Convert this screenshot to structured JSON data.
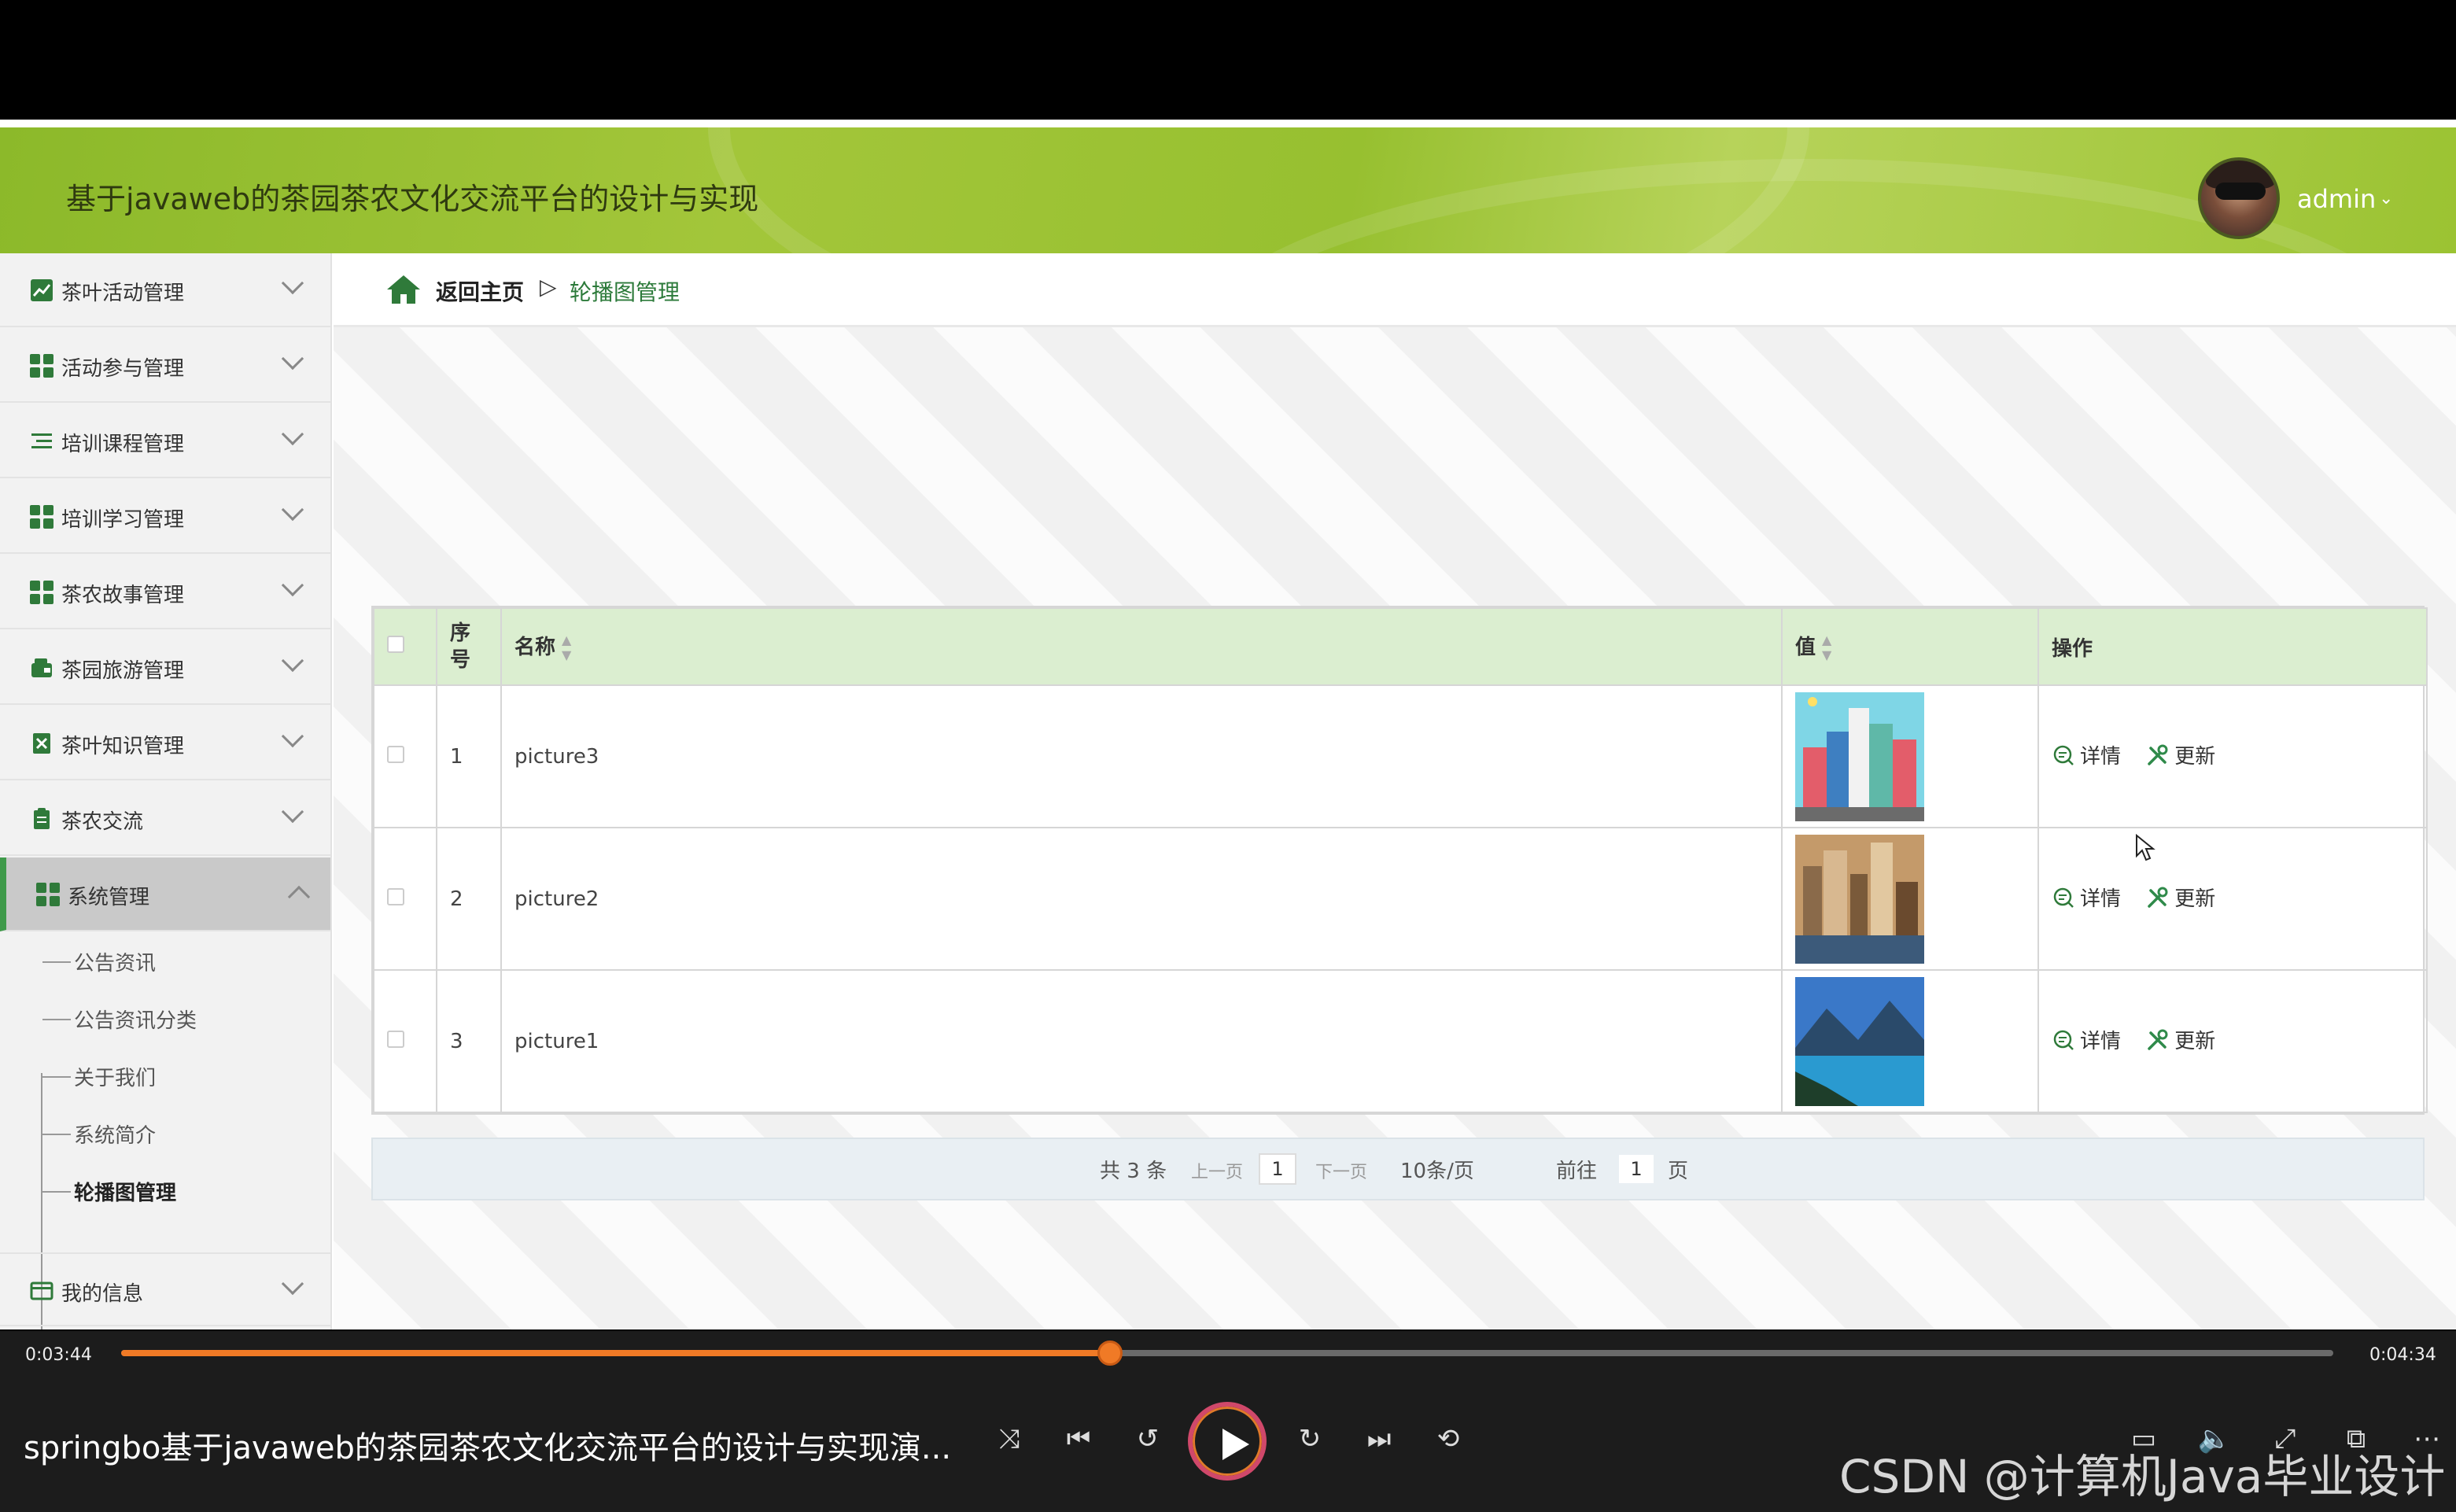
{
  "app": {
    "title": "基于javaweb的茶园茶农文化交流平台的设计与实现",
    "user": "admin",
    "user_caret": "⌄"
  },
  "sidebar": {
    "items": [
      {
        "label": "茶叶活动管理",
        "icon": "chart-icon"
      },
      {
        "label": "活动参与管理",
        "icon": "grid-icon"
      },
      {
        "label": "培训课程管理",
        "icon": "list-icon"
      },
      {
        "label": "培训学习管理",
        "icon": "grid-icon"
      },
      {
        "label": "茶农故事管理",
        "icon": "grid-icon"
      },
      {
        "label": "茶园旅游管理",
        "icon": "wallet-icon"
      },
      {
        "label": "茶叶知识管理",
        "icon": "book-icon"
      },
      {
        "label": "茶农交流",
        "icon": "clipboard-icon"
      },
      {
        "label": "系统管理",
        "icon": "grid-icon"
      },
      {
        "label": "我的信息",
        "icon": "card-icon"
      }
    ],
    "sub_items": [
      {
        "label": "公告资讯"
      },
      {
        "label": "公告资讯分类"
      },
      {
        "label": "关于我们"
      },
      {
        "label": "系统简介"
      },
      {
        "label": "轮播图管理"
      }
    ]
  },
  "breadcrumb": {
    "home": "返回主页",
    "separator": "▷",
    "current": "轮播图管理"
  },
  "table": {
    "headers": {
      "index": "序号",
      "name": "名称",
      "value": "值",
      "actions": "操作"
    },
    "rows": [
      {
        "index": "1",
        "name": "picture3",
        "image": "city-illustration"
      },
      {
        "index": "2",
        "name": "picture2",
        "image": "city-skyline-photo"
      },
      {
        "index": "3",
        "name": "picture1",
        "image": "mountain-lake-photo"
      }
    ],
    "action_detail": "详情",
    "action_update": "更新"
  },
  "pager": {
    "total": "共 3 条",
    "prev": "上一页",
    "current_page": "1",
    "next": "下一页",
    "page_size": "10条/页",
    "goto_label": "前往",
    "goto_value": "1",
    "goto_suffix": "页"
  },
  "player": {
    "time_now": "0:03:44",
    "time_end": "0:04:34",
    "progress": 0.447,
    "title": "springbo基于javaweb的茶园茶农文化交流平台的设计与实现演...",
    "watermark": "CSDN @计算机Java毕业设计"
  },
  "colors": {
    "header_green": "#97c030",
    "accent_green": "#2c7a3a",
    "table_header": "#dbeed0",
    "progress_orange": "#f07a26"
  }
}
